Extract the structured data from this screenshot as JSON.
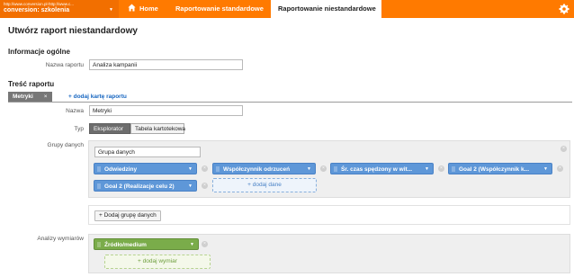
{
  "topbar": {
    "account_url": "http://www.conversion.pl-http://www.c...",
    "account_name": "conversion: szkolenia",
    "nav": {
      "home": "Home",
      "standard": "Raportowanie standardowe",
      "custom": "Raportowanie niestandardowe"
    },
    "colors": {
      "bar": "#ff7a00",
      "account": "#f26f00"
    }
  },
  "page": {
    "title": "Utwórz raport niestandardowy",
    "general_heading": "Informacje ogólne",
    "report_name_label": "Nazwa raportu",
    "report_name_value": "Analiza kampanii",
    "content_heading": "Treść raportu",
    "tab_label": "Metryki",
    "tab_close": "×",
    "add_tab": "+ dodaj kartę raportu",
    "name_label": "Nazwa",
    "name_value": "Metryki",
    "type_label": "Typ",
    "type_options": [
      "Eksplorator",
      "Tabela kartotekowa"
    ],
    "type_selected": "Eksplorator",
    "metric_groups_label": "Grupy danych",
    "group_name_value": "Grupa danych",
    "metrics": [
      "Odwiedziny",
      "Współczynnik odrzuceń",
      "Śr. czas spędzony w wit...",
      "Goal 2 (Współczynnik k...",
      "Goal 2 (Realizacje celu 2)"
    ],
    "add_metric": "+ dodaj dane",
    "add_group": "+ Dodaj grupę danych",
    "dimensions_label": "Analizy wymiarów",
    "dimensions": [
      "Źródło/medium"
    ],
    "add_dimension": "+ dodaj wymiar",
    "colors": {
      "metric_chip": "#5e97d8",
      "dimension_chip": "#7aac4a",
      "link": "#1565c0"
    }
  }
}
